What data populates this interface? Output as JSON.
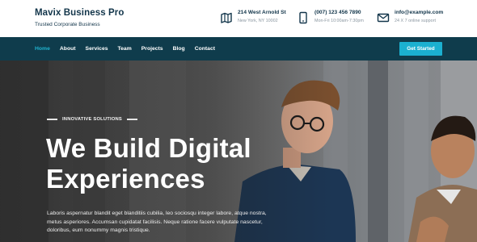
{
  "brand": {
    "name": "Mavix Business Pro",
    "tagline": "Trusted Corporate Business"
  },
  "contact": {
    "address": {
      "line1": "214 West Arnold St",
      "line2": "New York, NY 10002",
      "icon": "map-icon"
    },
    "phone": {
      "line1": "(007) 123 456 7890",
      "line2": "Mon-Fri 10:00am-7:30pm",
      "icon": "phone-icon"
    },
    "email": {
      "line1": "info@example.com",
      "line2": "24 X 7 online support",
      "icon": "mail-icon"
    }
  },
  "nav": {
    "items": [
      "Home",
      "About",
      "Services",
      "Team",
      "Projects",
      "Blog",
      "Contact"
    ],
    "active": "Home",
    "cta_label": "Get Started"
  },
  "hero": {
    "eyebrow": "INNOVATIVE SOLUTIONS",
    "headline_line1": "We Build Digital",
    "headline_line2": "Experiences",
    "paragraph_line1": "Laboris aspernatur blandit eget blanditiis cubilia, leo sociosqu integer labore, atque nostra,",
    "paragraph_line2": "metus asperiores. Accumsan cupidatat facilisis. Neque ratione facere vulputate nascetur,",
    "paragraph_line3": "doloribus, eum nonummy magnis tristique."
  },
  "colors": {
    "brand_dark": "#12354a",
    "navbar": "#0f3c4c",
    "accent": "#1bb0d0",
    "active_nav": "#20b3cf"
  }
}
